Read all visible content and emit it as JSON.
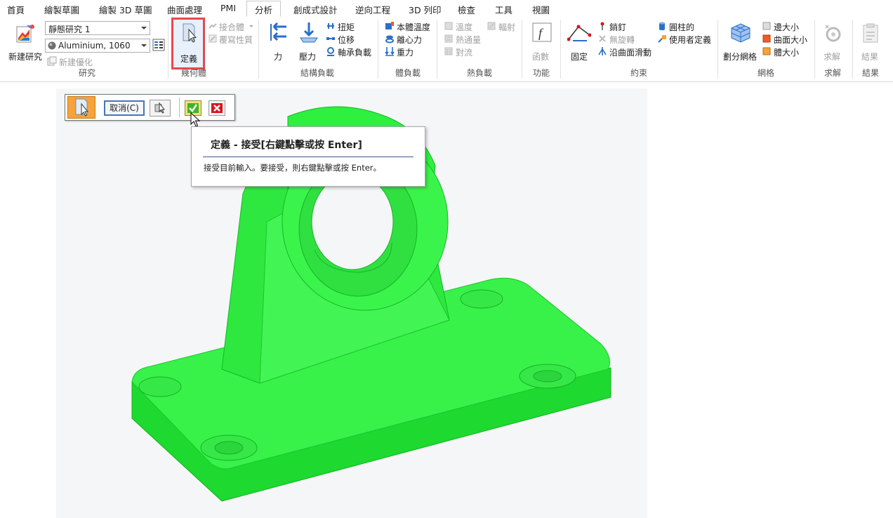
{
  "tabs": [
    "首頁",
    "繪製草圖",
    "繪製 3D 草圖",
    "曲面處理",
    "PMI",
    "分析",
    "創成式設計",
    "逆向工程",
    "3D 列印",
    "檢查",
    "工具",
    "視圖"
  ],
  "active_tab": "分析",
  "ribbon": {
    "study": {
      "new_study": "新建研究",
      "study_combo": "靜態研究 1",
      "material_combo": "Aluminium, 1060",
      "new_optimization": "新建優化",
      "group": "研究"
    },
    "geometry": {
      "define": "定義",
      "joint_body": "接合體",
      "overwrite_props": "覆寫性質",
      "group": "幾何體"
    },
    "structural_loads": {
      "force": "力",
      "pressure": "壓力",
      "torque": "扭矩",
      "displacement": "位移",
      "bearing_load": "軸承負載",
      "group": "結構負載"
    },
    "body_loads": {
      "body_temperature": "本體溫度",
      "centrifugal": "離心力",
      "gravity": "重力",
      "group": "體負載"
    },
    "thermal_loads": {
      "temperature": "溫度",
      "heat_flux": "熱通量",
      "convection": "對流",
      "radiation": "輻射",
      "group": "熱負載"
    },
    "functions": {
      "function": "函數",
      "group": "功能"
    },
    "constraints": {
      "fixed": "固定",
      "pin": "銷釘",
      "no_rotation": "無旋轉",
      "surface_slide": "沿曲面滑動",
      "cylindrical": "圓柱的",
      "user_defined": "使用者定義",
      "group": "約束"
    },
    "mesh": {
      "mesh": "劃分網格",
      "edge_size": "邊大小",
      "face_size": "曲面大小",
      "body_size": "體大小",
      "group": "網格"
    },
    "solve": {
      "solve": "求解",
      "group": "求解"
    },
    "results": {
      "results": "結果",
      "group": "結果"
    }
  },
  "command_bar": {
    "cancel_label": "取消(C)"
  },
  "tooltip": {
    "title": "定義 - 接受[右鍵點擊或按 Enter]",
    "body": "接受目前輸入。要接受，則右鍵點擊或按 Enter。"
  },
  "colors": {
    "highlight_red": "#e8484d",
    "model_green": "#2ef03f",
    "accept_green": "#3db52a",
    "cancel_red": "#d9141b",
    "active_icon_orange": "#f6a33c"
  }
}
